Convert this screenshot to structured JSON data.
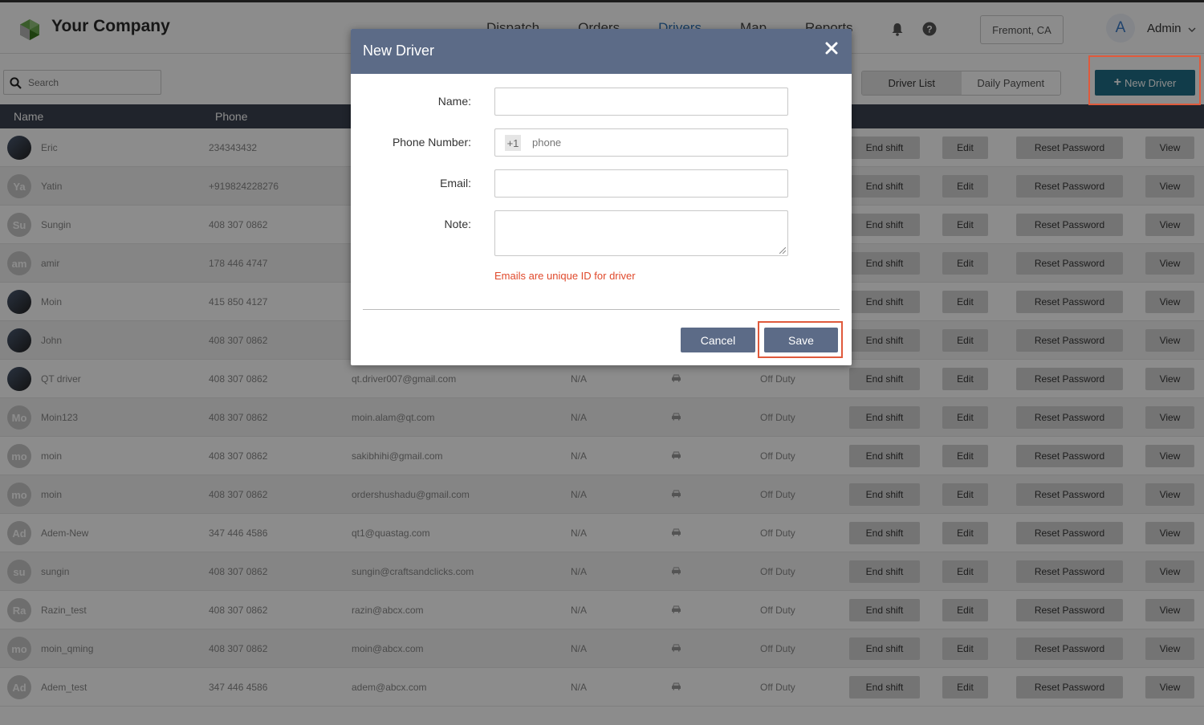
{
  "header": {
    "brand": "Your Company",
    "nav": [
      "Dispatch",
      "Orders",
      "Drivers",
      "Map",
      "Reports"
    ],
    "active_nav": "Drivers",
    "location": "Fremont, CA",
    "avatar_letter": "A",
    "user": "Admin",
    "icons": [
      "logo-icon",
      "bell-icon",
      "help-icon",
      "chevron-down-icon"
    ]
  },
  "toolbar": {
    "search_placeholder": "Search",
    "tabs": [
      "Driver List",
      "Daily Payment"
    ],
    "active_tab": "Driver List",
    "new_driver_label": "New Driver"
  },
  "table": {
    "columns": [
      "Name",
      "Phone"
    ],
    "rows": [
      {
        "initials": "",
        "photo": true,
        "name": "Eric",
        "phone": "234343432",
        "email": "",
        "status": ""
      },
      {
        "initials": "Ya",
        "photo": false,
        "name": "Yatin",
        "phone": "+919824228276",
        "email": "",
        "status": ""
      },
      {
        "initials": "Su",
        "photo": false,
        "name": "Sungin",
        "phone": "408 307 0862",
        "email": "",
        "status": ""
      },
      {
        "initials": "am",
        "photo": false,
        "name": "amir",
        "phone": "178 446 4747",
        "email": "",
        "status": ""
      },
      {
        "initials": "",
        "photo": true,
        "name": "Moin",
        "phone": "415 850 4127",
        "email": "",
        "status": ""
      },
      {
        "initials": "",
        "photo": true,
        "name": "John",
        "phone": "408 307 0862",
        "email": "",
        "status": ""
      },
      {
        "initials": "",
        "photo": true,
        "name": "QT driver",
        "phone": "408 307 0862",
        "email": "qt.driver007@gmail.com",
        "status": "Off Duty"
      },
      {
        "initials": "Mo",
        "photo": false,
        "name": "Moin123",
        "phone": "408 307 0862",
        "email": "moin.alam@qt.com",
        "status": "Off Duty"
      },
      {
        "initials": "mo",
        "photo": false,
        "name": "moin",
        "phone": "408 307 0862",
        "email": "sakibhihi@gmail.com",
        "status": "Off Duty"
      },
      {
        "initials": "mo",
        "photo": false,
        "name": "moin",
        "phone": "408 307 0862",
        "email": "ordershushadu@gmail.com",
        "status": "Off Duty"
      },
      {
        "initials": "Ad",
        "photo": false,
        "name": "Adem-New",
        "phone": "347 446 4586",
        "email": "qt1@quastag.com",
        "status": "Off Duty"
      },
      {
        "initials": "su",
        "photo": false,
        "name": "sungin",
        "phone": "408 307 0862",
        "email": "sungin@craftsandclicks.com",
        "status": "Off Duty"
      },
      {
        "initials": "Ra",
        "photo": false,
        "name": "Razin_test",
        "phone": "408 307 0862",
        "email": "razin@abcx.com",
        "status": "Off Duty"
      },
      {
        "initials": "mo",
        "photo": false,
        "name": "moin_qming",
        "phone": "408 307 0862",
        "email": "moin@abcx.com",
        "status": "Off Duty"
      },
      {
        "initials": "Ad",
        "photo": false,
        "name": "Adem_test",
        "phone": "347 446 4586",
        "email": "adem@abcx.com",
        "status": "Off Duty"
      }
    ],
    "na_value": "N/A",
    "actions": {
      "end_shift": "End shift",
      "edit": "Edit",
      "reset_password": "Reset Password",
      "view": "View"
    }
  },
  "modal": {
    "title": "New Driver",
    "fields": {
      "name_label": "Name:",
      "phone_label": "Phone Number:",
      "phone_prefix": "+1",
      "phone_placeholder": "phone",
      "email_label": "Email:",
      "note_label": "Note:"
    },
    "hint": "Emails are unique ID for driver",
    "cancel_label": "Cancel",
    "save_label": "Save",
    "colors": {
      "header": "#5c6b87",
      "hint": "#e0492b",
      "highlight": "#e05a3c"
    }
  }
}
